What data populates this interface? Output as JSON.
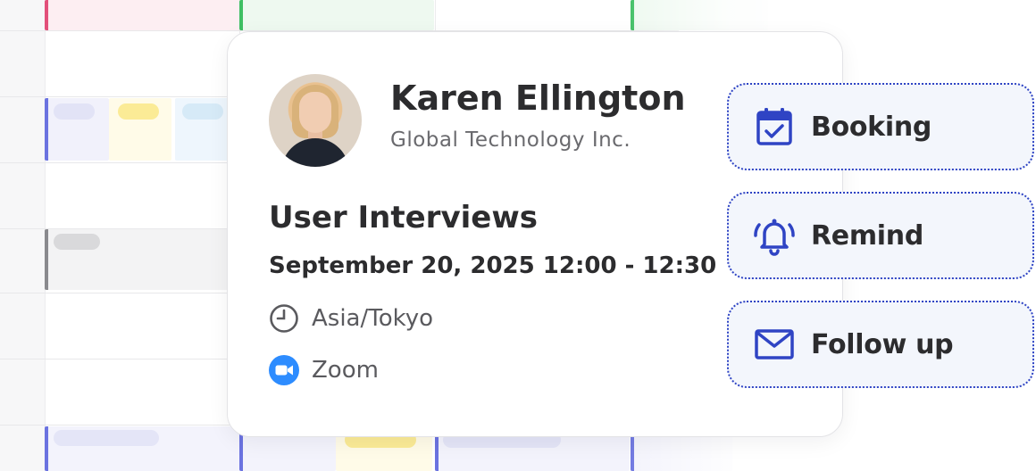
{
  "contact": {
    "name": "Karen Ellington",
    "company": "Global Technology Inc."
  },
  "event": {
    "title": "User Interviews",
    "datetime": "September 20, 2025 12:00 - 12:30",
    "timezone": "Asia/Tokyo",
    "location": "Zoom"
  },
  "actions": [
    {
      "label": "Booking",
      "icon": "calendar-check-icon"
    },
    {
      "label": "Remind",
      "icon": "bell-icon"
    },
    {
      "label": "Follow up",
      "icon": "envelope-icon"
    }
  ],
  "colors": {
    "accent": "#2f44c4",
    "zoom": "#2d8cff",
    "text": "#2c2c2e"
  }
}
